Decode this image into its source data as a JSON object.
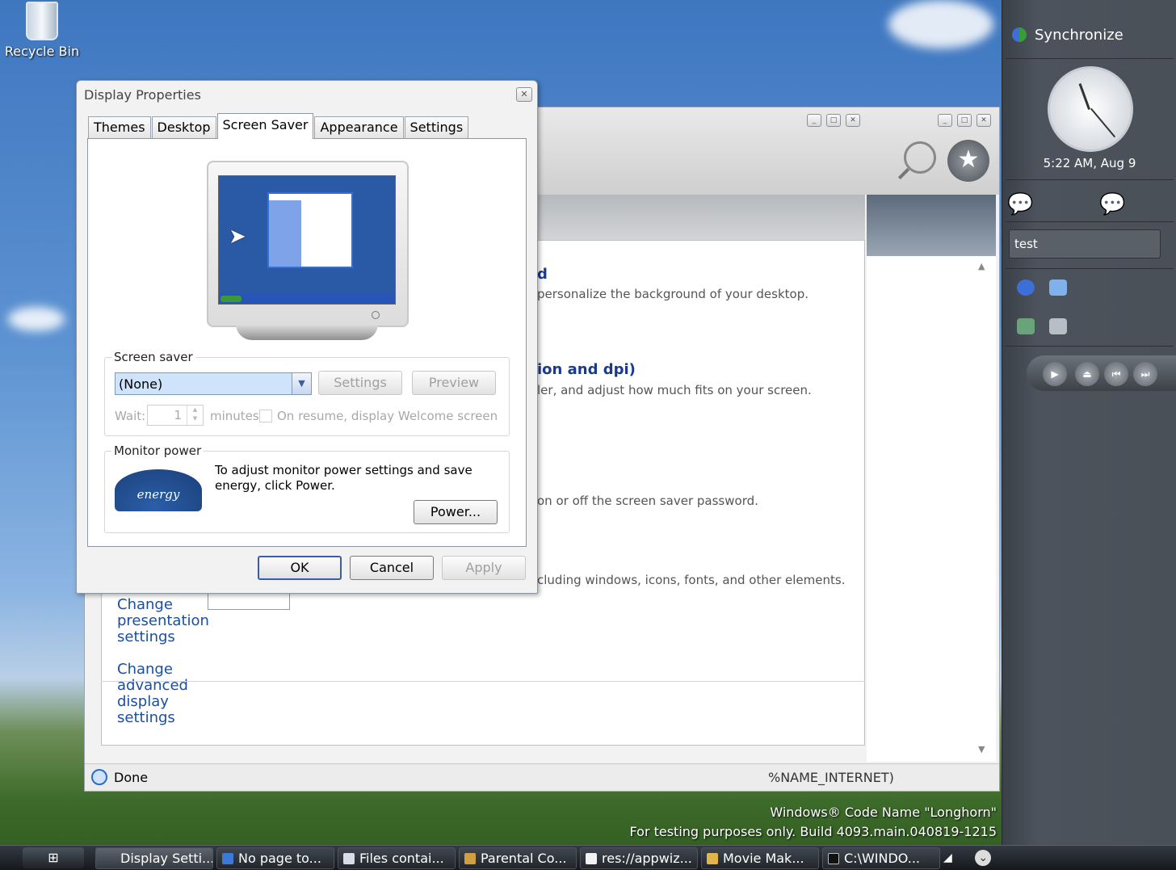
{
  "desktop": {
    "recycle_bin_label": "Recycle Bin",
    "watermark_line1": "Windows® Code Name \"Longhorn\"",
    "watermark_line2": "For testing purposes only. Build 4093.main.040819-1215"
  },
  "control_panel": {
    "heading1": "d",
    "desc1": "personalize the background of your desktop.",
    "heading2": "ion and dpi)",
    "desc2": "ler, and adjust how much fits on your screen.",
    "desc3": "on or off the screen saver password.",
    "desc4": "cluding windows, icons, fonts, and other elements.",
    "links": [
      "Change presentation settings",
      "Change advanced display settings"
    ],
    "status_text": "Done",
    "status_zone": "%NAME_INTERNET)"
  },
  "dialog": {
    "title": "Display Properties",
    "tabs": [
      "Themes",
      "Desktop",
      "Screen Saver",
      "Appearance",
      "Settings"
    ],
    "active_tab": "Screen Saver",
    "screen_saver_group_label": "Screen saver",
    "screen_saver_value": "(None)",
    "settings_button": "Settings",
    "preview_button": "Preview",
    "wait_label": "Wait:",
    "wait_value": "1",
    "minutes_label": "minutes",
    "resume_label": "On resume, display Welcome screen",
    "monitor_power_label": "Monitor power",
    "monitor_power_text": "To adjust monitor power settings and save energy, click Power.",
    "power_button": "Power...",
    "energy_logo_text": "energy",
    "ok_button": "OK",
    "cancel_button": "Cancel",
    "apply_button": "Apply"
  },
  "sidebar": {
    "synchronize_label": "Synchronize",
    "clock_time": "5:22 AM, Aug 9",
    "note_text": "test"
  },
  "taskbar": {
    "items": [
      "Display Setti...",
      "No page to...",
      "Files contai...",
      "Parental Co...",
      "res://appwiz...",
      "Movie Mak...",
      "C:\\WINDO..."
    ]
  }
}
